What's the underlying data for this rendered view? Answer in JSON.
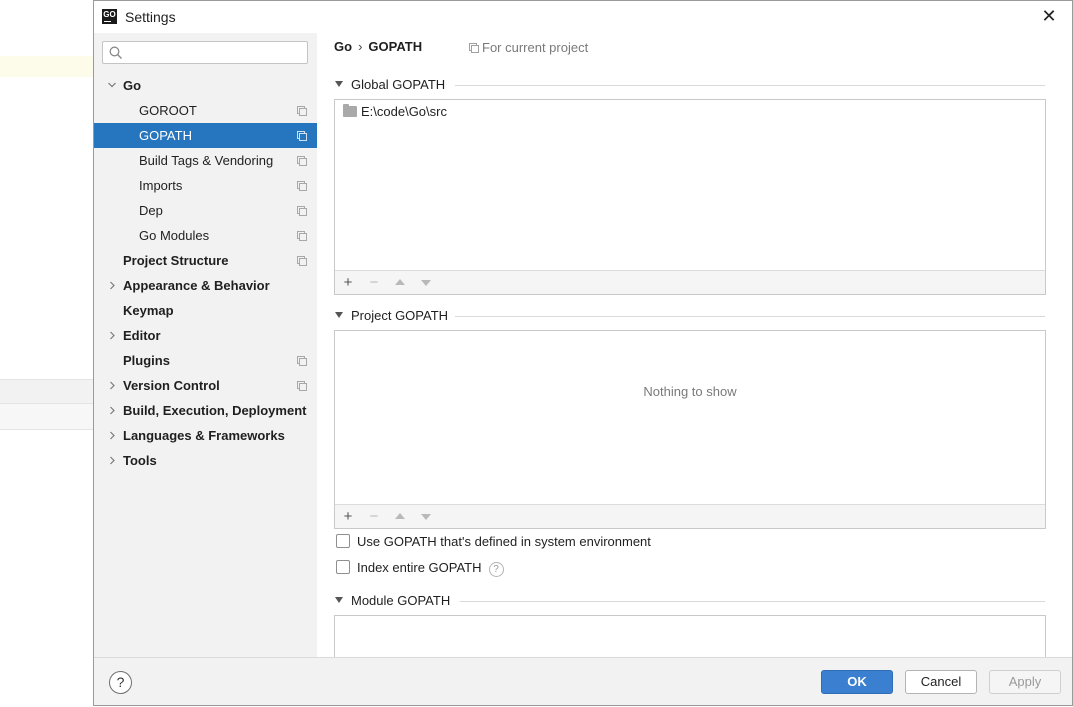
{
  "window": {
    "title": "Settings",
    "app_icon_text": "GO"
  },
  "search": {
    "value": "",
    "placeholder": ""
  },
  "sidebar": {
    "items": [
      {
        "label": "Go",
        "level": 0,
        "expanded": true,
        "bold": true,
        "has_project_icon": false
      },
      {
        "label": "GOROOT",
        "level": 1,
        "bold": false,
        "has_project_icon": true
      },
      {
        "label": "GOPATH",
        "level": 1,
        "bold": false,
        "selected": true,
        "has_project_icon": true
      },
      {
        "label": "Build Tags & Vendoring",
        "level": 1,
        "bold": false,
        "has_project_icon": true
      },
      {
        "label": "Imports",
        "level": 1,
        "bold": false,
        "has_project_icon": true
      },
      {
        "label": "Dep",
        "level": 1,
        "bold": false,
        "has_project_icon": true
      },
      {
        "label": "Go Modules",
        "level": 1,
        "bold": false,
        "has_project_icon": true
      },
      {
        "label": "Project Structure",
        "level": 0,
        "bold": true,
        "has_project_icon": true
      },
      {
        "label": "Appearance & Behavior",
        "level": 0,
        "collapsed": true,
        "bold": true,
        "has_project_icon": false
      },
      {
        "label": "Keymap",
        "level": 0,
        "bold": true,
        "has_project_icon": false
      },
      {
        "label": "Editor",
        "level": 0,
        "collapsed": true,
        "bold": true,
        "has_project_icon": false
      },
      {
        "label": "Plugins",
        "level": 0,
        "bold": true,
        "has_project_icon": true
      },
      {
        "label": "Version Control",
        "level": 0,
        "collapsed": true,
        "bold": true,
        "has_project_icon": true
      },
      {
        "label": "Build, Execution, Deployment",
        "level": 0,
        "collapsed": true,
        "bold": true,
        "has_project_icon": false
      },
      {
        "label": "Languages & Frameworks",
        "level": 0,
        "collapsed": true,
        "bold": true,
        "has_project_icon": false
      },
      {
        "label": "Tools",
        "level": 0,
        "collapsed": true,
        "bold": true,
        "has_project_icon": false
      }
    ]
  },
  "breadcrumb": {
    "parent": "Go",
    "separator": "›",
    "current": "GOPATH",
    "scope": "For current project"
  },
  "global_gopath": {
    "title": "Global GOPATH",
    "entries": [
      "E:\\code\\Go\\src"
    ]
  },
  "project_gopath": {
    "title": "Project GOPATH",
    "empty_text": "Nothing to show"
  },
  "options": {
    "use_system_gopath": {
      "label": "Use GOPATH that's defined in system environment",
      "checked": false
    },
    "index_entire_gopath": {
      "label": "Index entire GOPATH",
      "checked": false
    }
  },
  "module_gopath": {
    "title": "Module GOPATH"
  },
  "toolbar": {
    "add": "+",
    "remove": "−"
  },
  "footer": {
    "help": "?",
    "ok": "OK",
    "cancel": "Cancel",
    "apply": "Apply"
  },
  "colors": {
    "selection": "#2675bf",
    "ok_button": "#3a7fd0",
    "sidebar_bg": "#f2f2f2"
  }
}
